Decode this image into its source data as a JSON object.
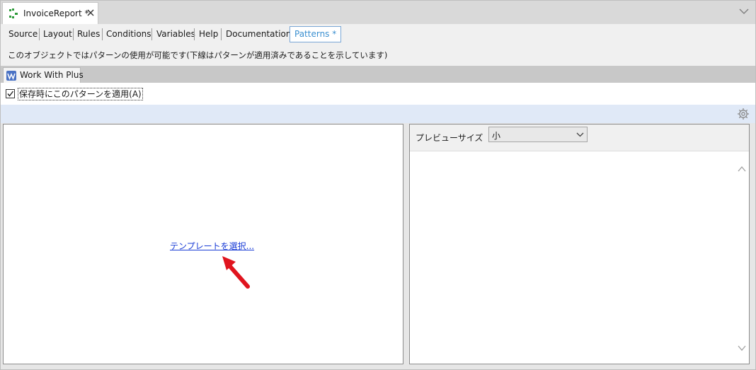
{
  "doc_tab": {
    "title": "InvoiceReport *",
    "icon": "report-object-icon",
    "close_icon": "close-icon"
  },
  "editor_tabs": [
    {
      "label": "Source"
    },
    {
      "label": "Layout"
    },
    {
      "label": "Rules"
    },
    {
      "label": "Conditions"
    },
    {
      "label": "Variables"
    },
    {
      "label": "Help"
    },
    {
      "label": "Documentation"
    },
    {
      "label": "Patterns *"
    }
  ],
  "pattern_info": "このオブジェクトではパターンの使用が可能です(下線はパターンが適用済みであることを示しています)",
  "pattern_tab": {
    "label": "Work With Plus",
    "icon": "wwp-icon"
  },
  "apply_on_save": {
    "label": "保存時にこのパターンを適用(A)",
    "checked": true
  },
  "template_link": "テンプレートを選択...",
  "preview": {
    "label": "プレビューサイズ",
    "size_value": "小"
  },
  "colors": {
    "active_tab": "#3a8fd0",
    "link": "#1a3cd6",
    "arrow": "#e0141e",
    "toolbar_strip": "#e0e9f7"
  }
}
